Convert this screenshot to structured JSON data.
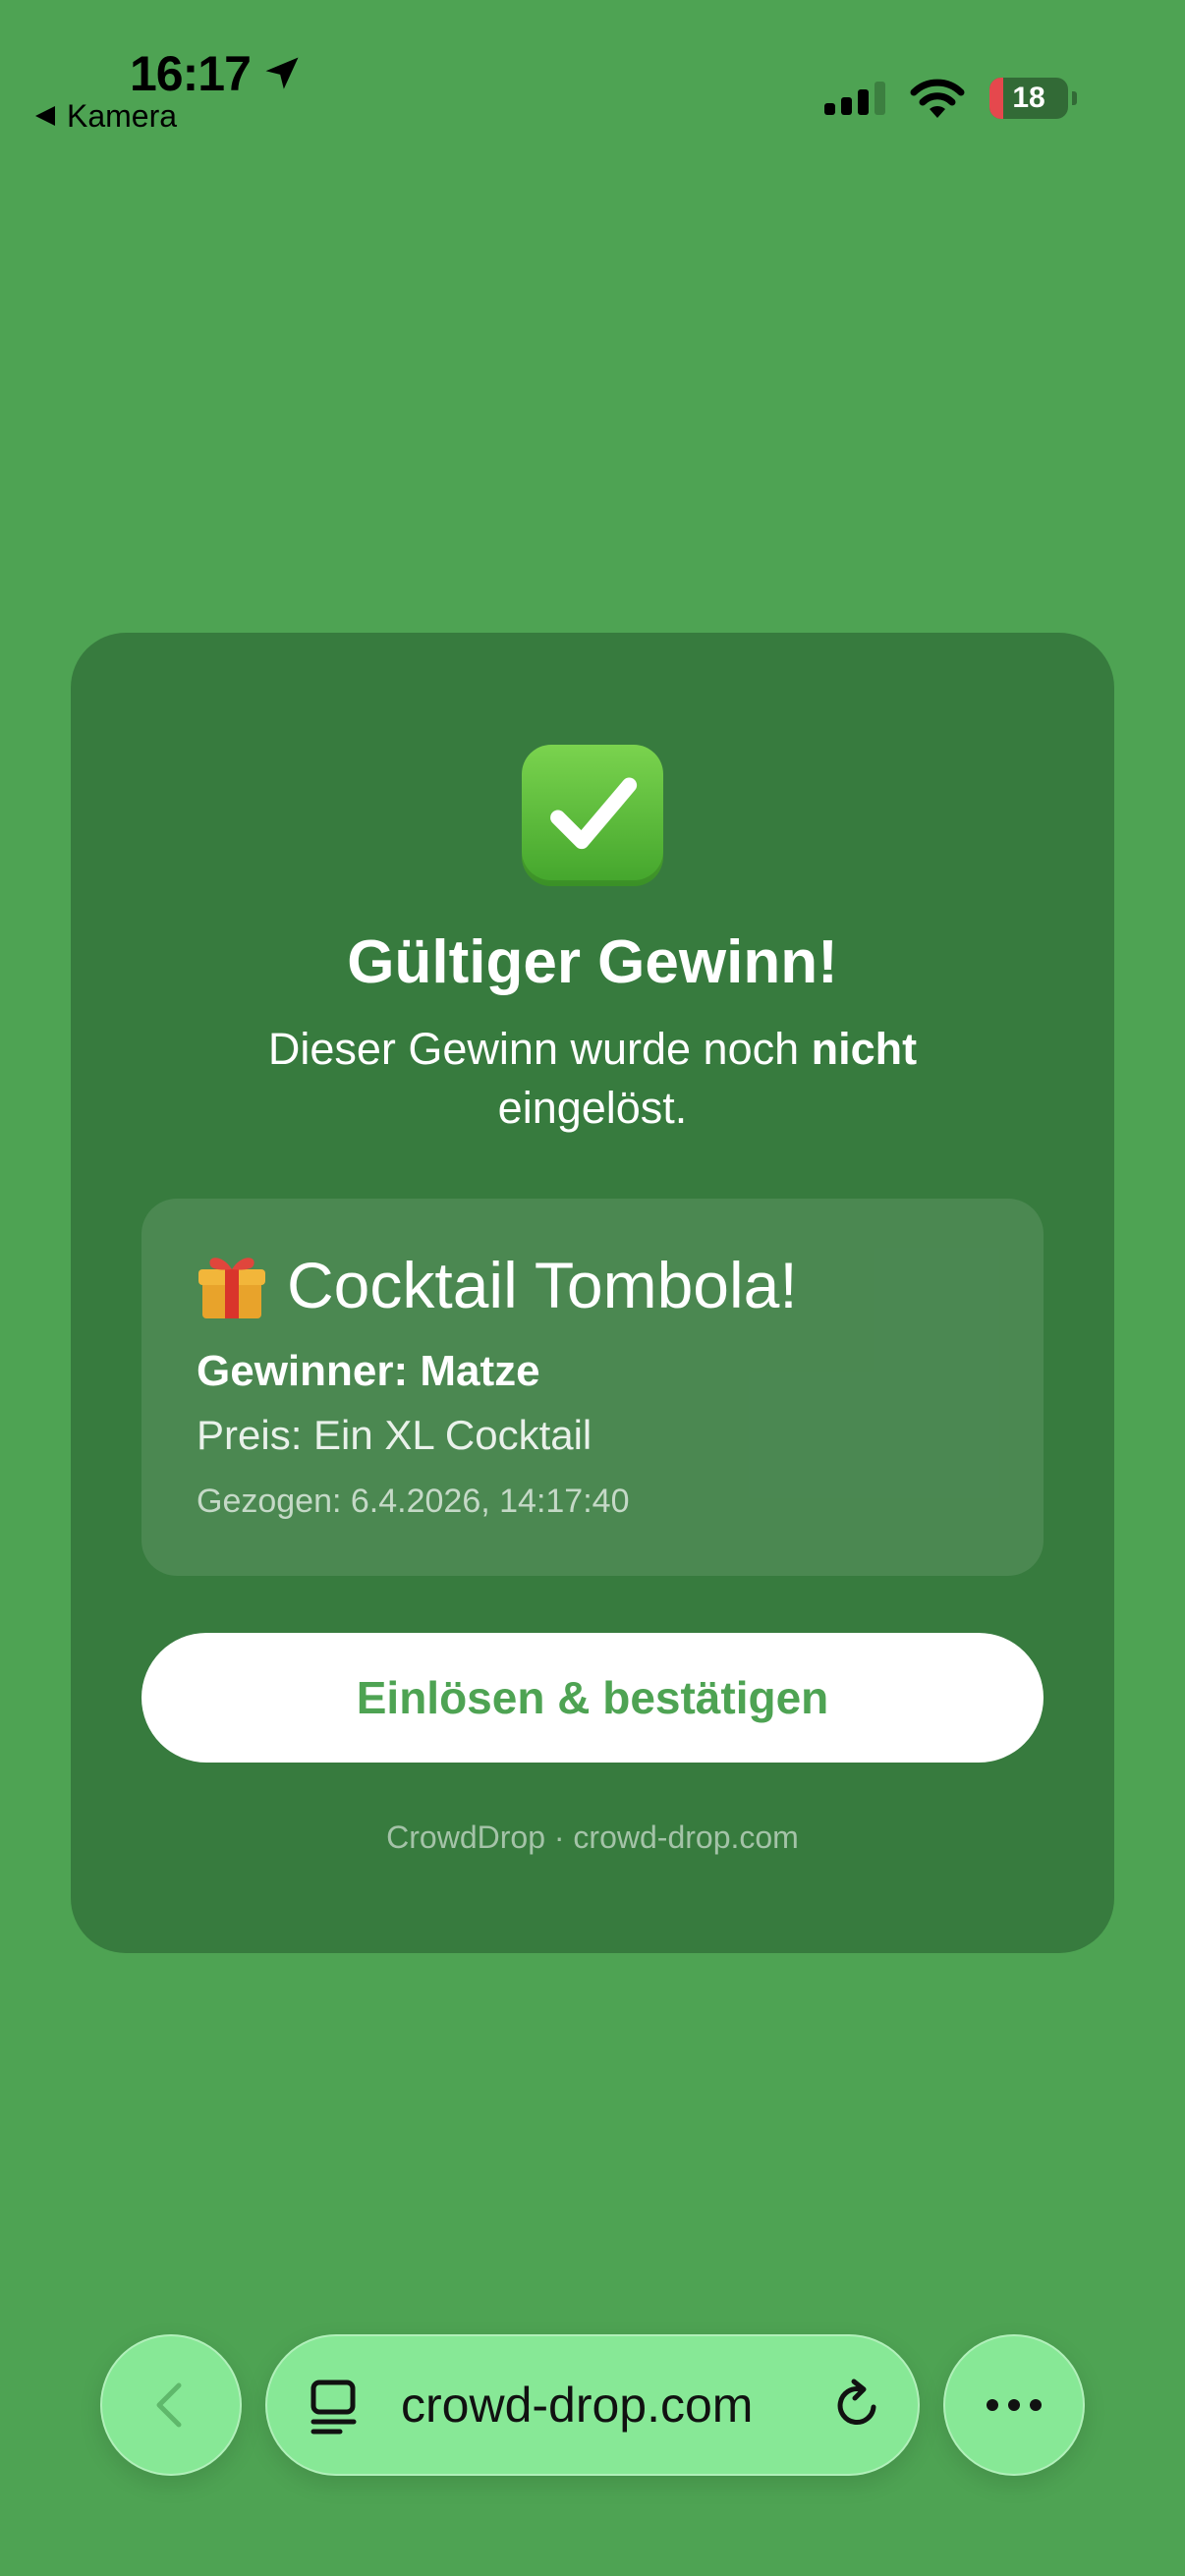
{
  "status_bar": {
    "time": "16:17",
    "back_app": "Kamera",
    "battery": "18",
    "battery_level": 0.18
  },
  "card": {
    "title": "Gültiger Gewinn!",
    "subtitle_pre": "Dieser Gewinn wurde noch ",
    "subtitle_bold": "nicht",
    "subtitle_post": " eingelöst.",
    "prize": {
      "name": "Cocktail Tombola!",
      "winner": "Gewinner: Matze",
      "prize": "Preis: Ein XL Cocktail",
      "drawn": "Gezogen: 6.4.2026, 14:17:40"
    },
    "button_label": "Einlösen & bestätigen",
    "footer": "CrowdDrop · crowd-drop.com"
  },
  "browser": {
    "url": "crowd-drop.com"
  },
  "colors": {
    "background": "#4ea353",
    "card": "#377b3e",
    "button_text": "#4ea353",
    "toolbar": "#87e896"
  }
}
